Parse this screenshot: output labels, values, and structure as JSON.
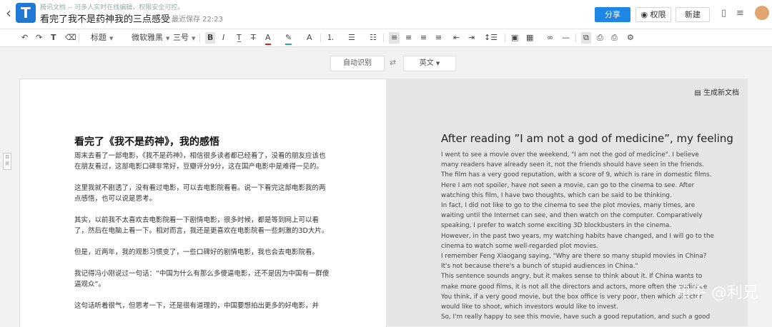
{
  "header": {
    "notice": "腾讯文档 -- 可多人实时在线编辑，权限安全可控。",
    "doc_title": "看完了我不是药神我的三点感受",
    "save_status": "最近保存 22:23",
    "share_label": "分享",
    "permission_label": "权限",
    "new_label": "新建"
  },
  "toolbar": {
    "style_select": "标题",
    "font_select": "微软雅黑",
    "size_select": "三号"
  },
  "translate_bar": {
    "source_label": "自动识别",
    "swap_glyph": "⇄",
    "target_label": "英文"
  },
  "sidebar_tab_label": "目录",
  "left_doc": {
    "title": "看完了《我不是药神》，我的感悟",
    "paragraphs": [
      "周末去看了一部电影，《我不是药神》，相信很多读者都已经看了，没看的朋友应该也在朋友看过，这部电影口碑非常好，豆瓣评分9分，这在国产电影中是难得一见的。",
      "这里我就不剧透了，没有看过电影，可以去电影院看看。说一下看完这部电影我的两点感悟，也可以说是思考。",
      "其实，以前我不太喜欢去电影院看一下剧情电影，很多时候，都是等到网上可以看了，然后在电脑上看一下。相对而言，我还是更喜欢在电影院看一些刺激的3D大片。",
      "但是，近两年，我的观影习惯变了，一些口碑好的剧情电影，我也会去电影院看。",
      "我记得冯小刚说过一句话：“中国为什么有那么多傻逼电影，还不是因为中国有一群傻逼观众”。",
      "这句话听着很气，但思考一下，还是很有道理的，中国要想拍出更多的好电影，并"
    ]
  },
  "right_doc": {
    "generate_label": "生成新文档",
    "title": "After reading ”I am not a god of medicine”, my feeling",
    "lines": [
      "I went to see a movie over the weekend, \"I am not the god of medicine\". I believe",
      "many readers have already seen it, not the friends should have seen in the friends.",
      "The film has a very good reputation, with a score of 9, which is rare in domestic films.",
      "Here I am not spoiler, have not seen a movie, can go to the cinema to see. After",
      "watching this film, I have two thoughts, which can be said to be thinking.",
      "In fact, I did not like to go to the cinema to see the plot movies, many times, are",
      "waiting until the Internet can see, and then watch on the computer. Comparatively",
      "speaking, I prefer to watch some exciting 3D blockbusters in the cinema.",
      "However, in the past two years, my watching habits have changed, and I will go to the",
      "cinema to watch some well-regarded plot movies.",
      "I remember Feng Xiaogang saying, \"Why are there so many stupid movies in China?",
      "It's not because there's a bunch of stupid audiences in China.\"",
      "This sentence sounds angry, but it makes sense to think about it. If China wants to",
      "make more good films, it is not all the directors and actors, more often the audience",
      "You think, if a very good movie, but the box office is very poor, then which director",
      "would like to shoot, which investors would like to invest.",
      "So, I'm really happy to see this movie, have such a good reputation, and such a good"
    ]
  },
  "watermark": "知乎 @利兄"
}
